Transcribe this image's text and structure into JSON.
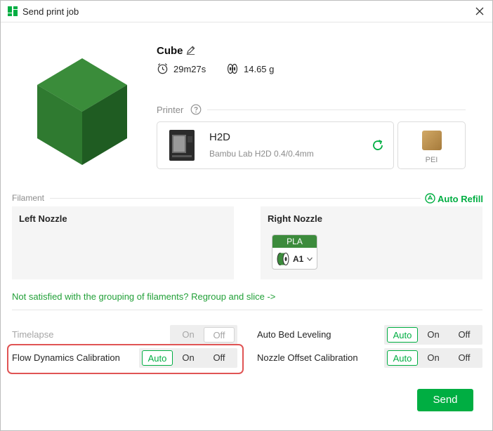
{
  "window": {
    "title": "Send print job",
    "colors": {
      "accent": "#00ae42",
      "highlight": "#e05454"
    }
  },
  "model": {
    "name": "Cube",
    "print_time": "29m27s",
    "weight": "14.65 g"
  },
  "printer": {
    "section_label": "Printer",
    "name": "H2D",
    "model_detail": "Bambu Lab H2D  0.4/0.4mm",
    "plate_label": "PEI"
  },
  "filament": {
    "section_label": "Filament",
    "auto_refill_label": "Auto Refill",
    "left_nozzle_title": "Left Nozzle",
    "right_nozzle_title": "Right Nozzle",
    "right_chip": {
      "material": "PLA",
      "slot": "A1",
      "color": "#3c8b3c"
    },
    "regroup_text": "Not satisfied with the grouping of filaments? Regroup and slice ->"
  },
  "options": {
    "timelapse": {
      "label": "Timelapse",
      "on": "On",
      "off": "Off",
      "selected": "Off",
      "disabled": true
    },
    "flow_dynamics": {
      "label": "Flow Dynamics Calibration",
      "auto": "Auto",
      "on": "On",
      "off": "Off",
      "selected": "Auto"
    },
    "auto_bed_leveling": {
      "label": "Auto Bed Leveling",
      "auto": "Auto",
      "on": "On",
      "off": "Off",
      "selected": "Auto"
    },
    "nozzle_offset": {
      "label": "Nozzle Offset Calibration",
      "auto": "Auto",
      "on": "On",
      "off": "Off",
      "selected": "Auto"
    }
  },
  "actions": {
    "send_label": "Send"
  }
}
